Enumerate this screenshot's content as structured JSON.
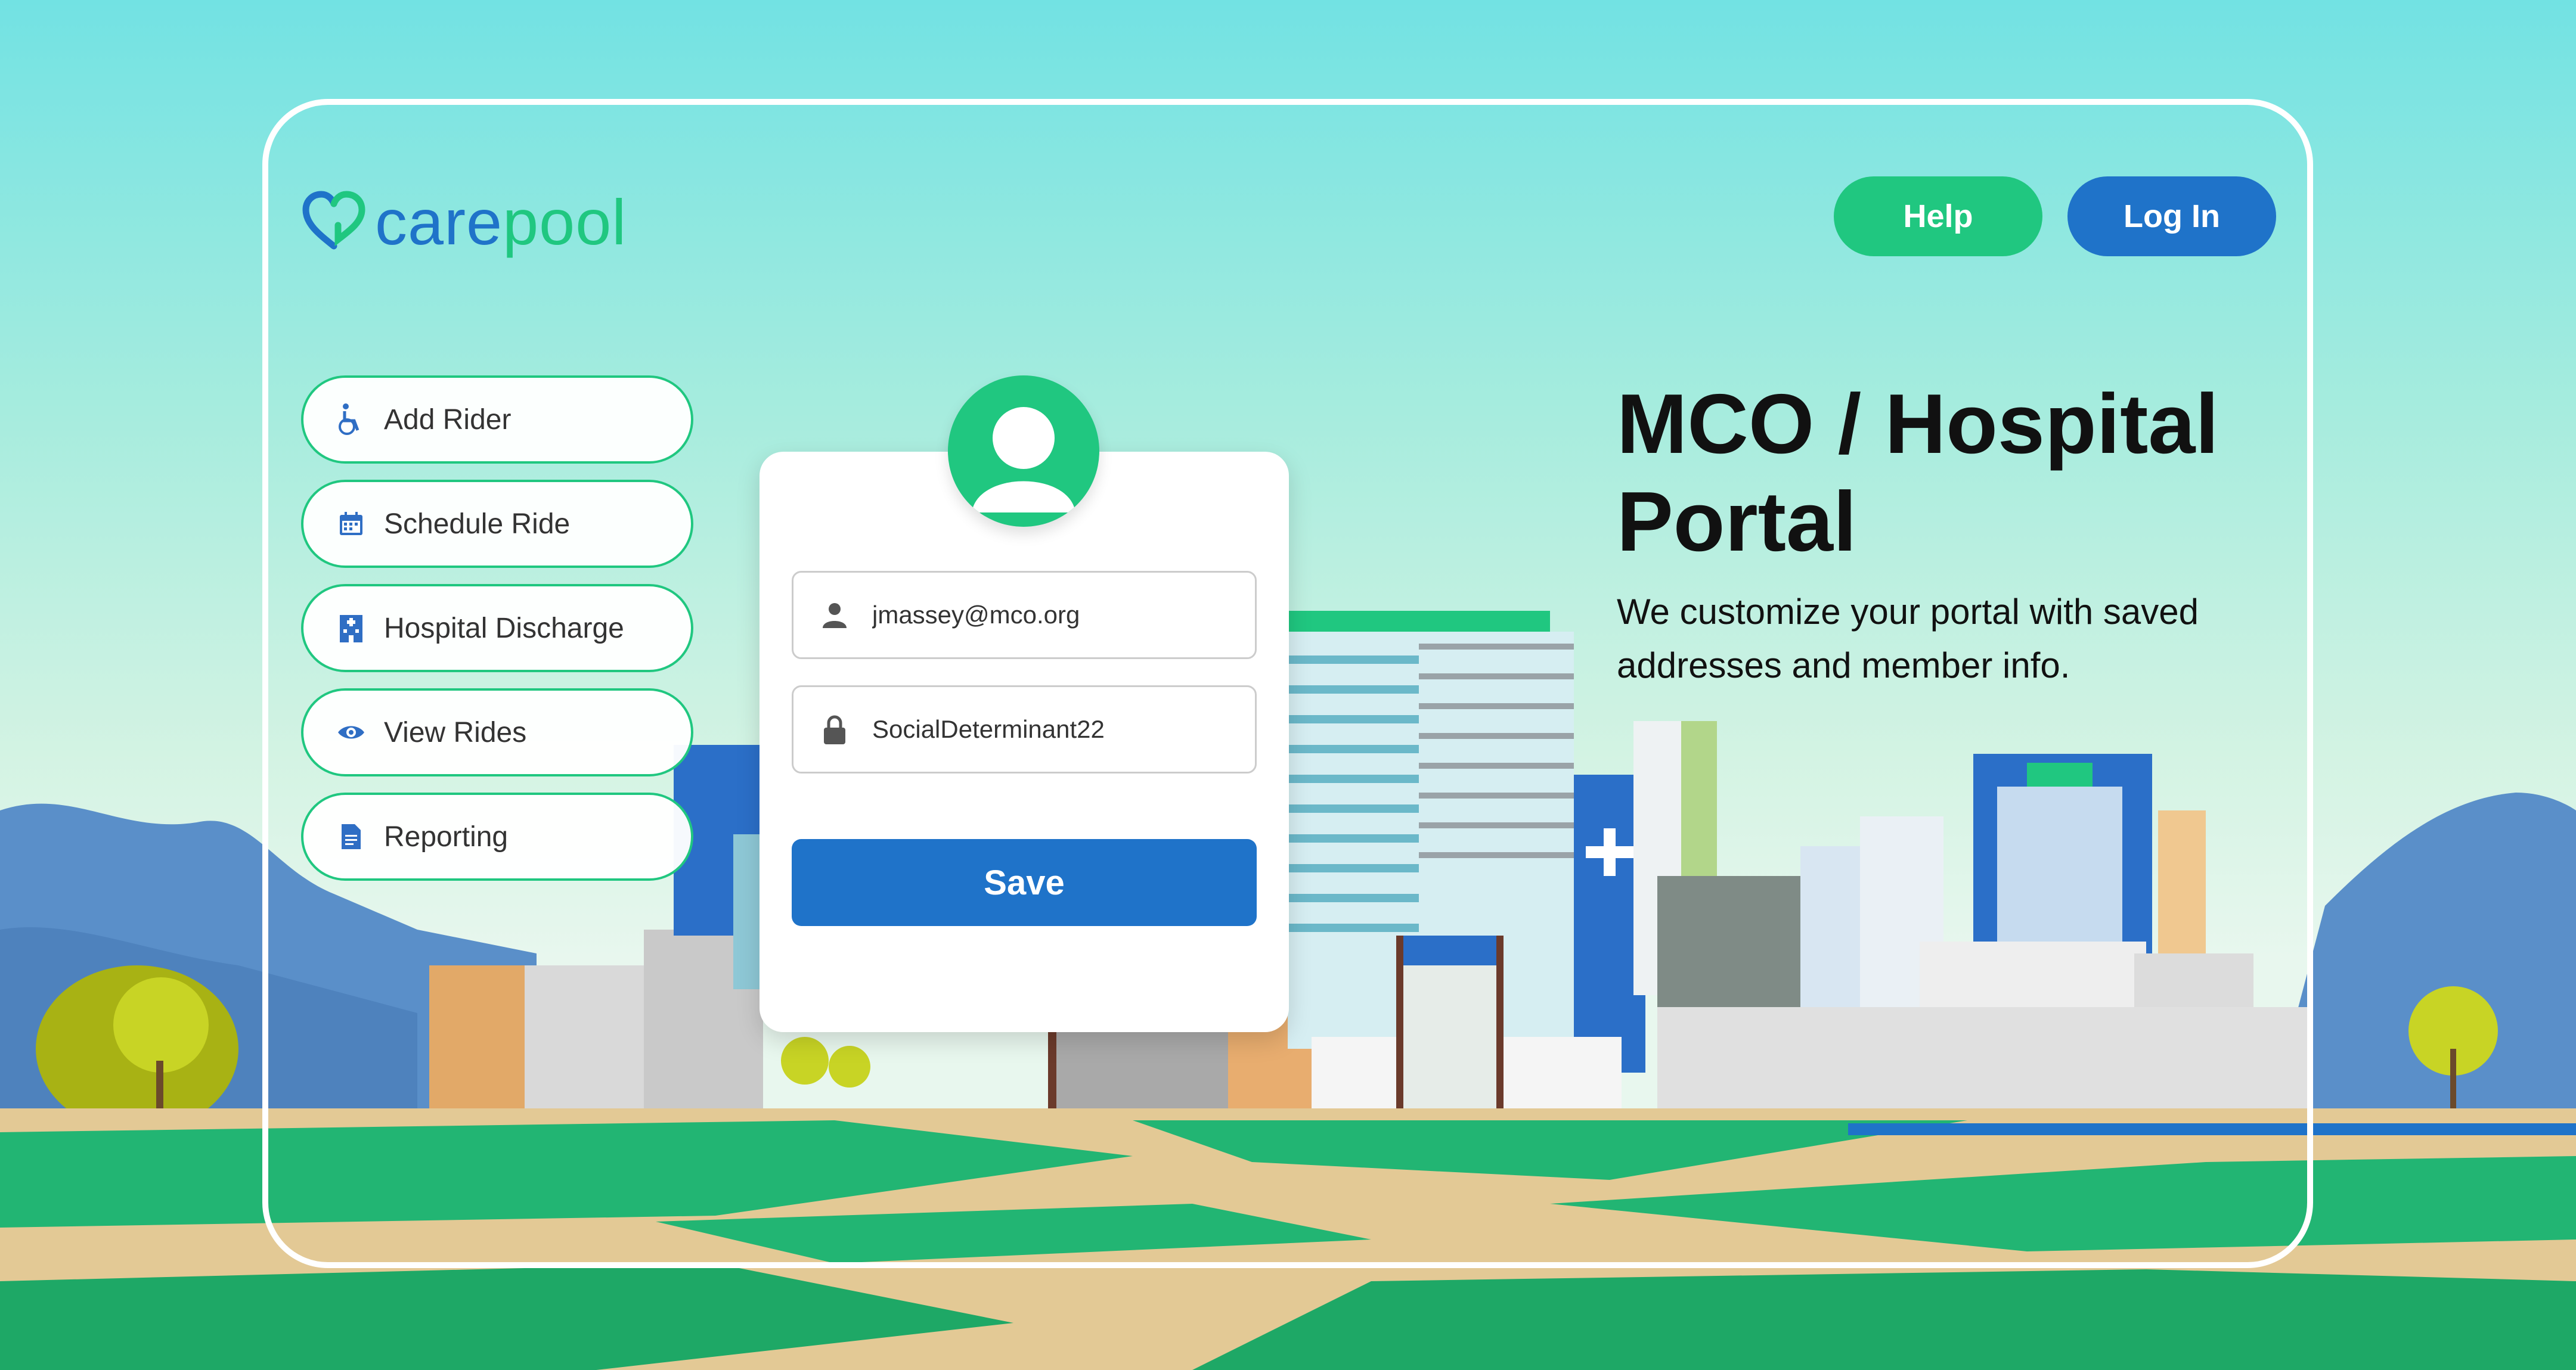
{
  "brand": {
    "name_part1": "care",
    "name_part2": "pool",
    "primary_color": "#1f73c9",
    "accent_color": "#20c780"
  },
  "header": {
    "help_label": "Help",
    "login_label": "Log In"
  },
  "sidebar": {
    "items": [
      {
        "label": "Add Rider",
        "icon": "wheelchair-icon"
      },
      {
        "label": "Schedule Ride",
        "icon": "calendar-icon"
      },
      {
        "label": "Hospital Discharge",
        "icon": "hospital-icon"
      },
      {
        "label": "View Rides",
        "icon": "eye-icon"
      },
      {
        "label": "Reporting",
        "icon": "document-icon"
      }
    ]
  },
  "login_form": {
    "email_value": "jmassey@mco.org",
    "password_value": "SocialDeterminant22",
    "save_label": "Save"
  },
  "hero": {
    "title": "MCO / Hospital Portal",
    "subtitle": "We customize your portal with saved addresses and member info."
  }
}
